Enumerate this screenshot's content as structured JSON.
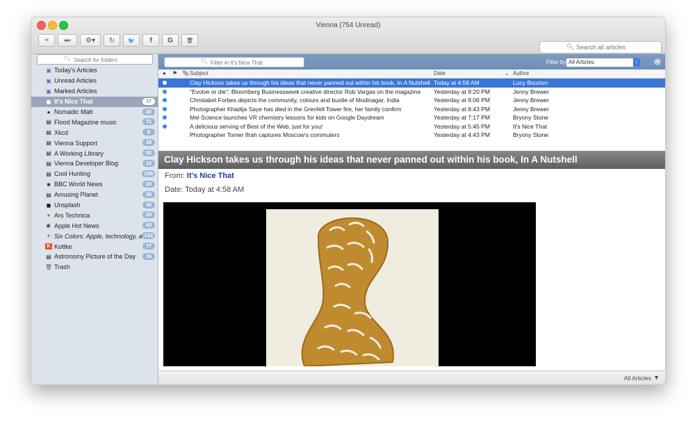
{
  "window": {
    "title": "Vienna (754 Unread)"
  },
  "toolbar": {
    "buttons": [
      {
        "name": "new-subscription-button",
        "glyph": "+"
      },
      {
        "name": "next-unread-button",
        "glyph": "⏭"
      },
      {
        "name": "action-menu-button",
        "glyph": "⚙▾"
      },
      {
        "name": "refresh-button",
        "glyph": "↻"
      },
      {
        "name": "twitter-share-button",
        "glyph": "🐦"
      },
      {
        "name": "facebook-share-button",
        "glyph": "f"
      },
      {
        "name": "google-share-button",
        "glyph": "G"
      },
      {
        "name": "delete-button",
        "glyph": "🗑"
      }
    ],
    "search_placeholder": "Search all articles"
  },
  "sidebar": {
    "search_placeholder": "Search for folders",
    "folders": [
      {
        "label": "Today's Articles",
        "icon": "▣",
        "badge": ""
      },
      {
        "label": "Unread Articles",
        "icon": "▣",
        "badge": ""
      },
      {
        "label": "Marked Articles",
        "icon": "▣",
        "badge": ""
      },
      {
        "label": "It's Nice That",
        "icon": "◉",
        "badge": "37",
        "selected": true
      },
      {
        "label": "Nomadic Matt",
        "icon": "●",
        "badge": "20"
      },
      {
        "label": "Flood Magazine music",
        "icon": "▤",
        "badge": "71"
      },
      {
        "label": "Xkcd",
        "icon": "▤",
        "badge": "8"
      },
      {
        "label": "Vienna Support",
        "icon": "▤",
        "badge": "28"
      },
      {
        "label": "A Working Library",
        "icon": "▤",
        "badge": "52"
      },
      {
        "label": "Vienna Developer Blog",
        "icon": "▤",
        "badge": "12"
      },
      {
        "label": "Cool Hunting",
        "icon": "▤",
        "badge": "100"
      },
      {
        "label": "BBC World News",
        "icon": "■",
        "badge": "24"
      },
      {
        "label": "Amusing Planet",
        "icon": "▤",
        "badge": "36"
      },
      {
        "label": "Unsplash",
        "icon": "◼",
        "badge": "30"
      },
      {
        "label": "Ars Technica",
        "icon": "●",
        "badge": "20"
      },
      {
        "label": "Apple Hot News",
        "icon": "",
        "badge": "43"
      },
      {
        "label": "Six Colors: Apple, technology, a",
        "icon": "✦",
        "badge": "132"
      },
      {
        "label": "Kottke",
        "icon": "K",
        "badge": "77"
      },
      {
        "label": "Astronomy Picture of the Day",
        "icon": "▤",
        "badge": "16"
      },
      {
        "label": "Trash",
        "icon": "🗑",
        "badge": ""
      }
    ]
  },
  "article_list": {
    "filter_placeholder": "Filter in It's Nice That",
    "filter_by_label": "Filter by:",
    "filter_value": "All Articles",
    "columns": {
      "subject": "Subject",
      "date": "Date",
      "author": "Author"
    },
    "rows": [
      {
        "subject": "Clay Hickson takes us through his ideas that never panned out within his book, In A Nutshell",
        "date": "Today at 4:58 AM",
        "author": "Lucy Bourton",
        "selected": true
      },
      {
        "subject": "\"Evolve or die\": Bloomberg Businessweek creative director Rob Vargas on the magazine",
        "date": "Yesterday at 9:20 PM",
        "author": "Jenny Brewer"
      },
      {
        "subject": "Christabel Forbes depicts the community, colours and bustle of Modinagar, India",
        "date": "Yesterday at 9:06 PM",
        "author": "Jenny Brewer"
      },
      {
        "subject": "Photographer Khadija Saye has died in the Grenfell Tower fire, her family confirm",
        "date": "Yesterday at 8:43 PM",
        "author": "Jenny Brewer"
      },
      {
        "subject": "Mel Science launches VR chemistry lessons for kids on Google Daydream",
        "date": "Yesterday at 7:17 PM",
        "author": "Bryony Stone"
      },
      {
        "subject": "A delicious serving of Best of the Web, just for you!",
        "date": "Yesterday at 5:45 PM",
        "author": "It's Nice That"
      },
      {
        "subject": "Photographer Tomer Ifrah captures Moscow's commuters",
        "date": "Yesterday at 4:43 PM",
        "author": "Bryony Stone"
      }
    ]
  },
  "reading_pane": {
    "headline": "Clay Hickson takes us through his ideas that never panned out within his book, In A Nutshell",
    "from_label": "From:",
    "from_value": "It's Nice That",
    "date_label": "Date:",
    "date_value": "Today at 4:58 AM"
  },
  "statusbar": {
    "filter_label": "All Articles"
  }
}
